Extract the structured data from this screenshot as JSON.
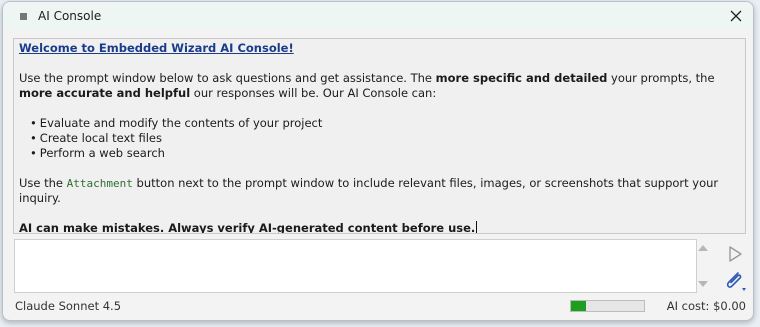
{
  "window": {
    "title": "AI Console"
  },
  "output": {
    "welcome": "Welcome to Embedded Wizard AI Console!",
    "intro": {
      "p1": "Use the prompt window below to ask questions and get assistance. The ",
      "b1": "more specific and detailed",
      "p2": " your prompts, the ",
      "b2": "more accurate and helpful",
      "p3": " our responses will be. Our AI Console can:"
    },
    "capabilities": [
      "Evaluate and modify the contents of your project",
      "Create local text files",
      "Perform a web search"
    ],
    "attachment_note": {
      "before": "Use the ",
      "keyword": "Attachment",
      "after": " button next to the prompt window to include relevant files, images, or screenshots that support your inquiry."
    },
    "warning": "AI can make mistakes. Always verify AI-generated content before use."
  },
  "prompt": {
    "value": ""
  },
  "status": {
    "model": "Claude Sonnet 4.5",
    "progress_fraction": 0.2,
    "cost": "AI cost: $0.00"
  },
  "icons": {
    "title": "window-icon",
    "close": "close-icon",
    "send": "send-icon",
    "attach": "paperclip-icon",
    "scroll_up": "scroll-up-icon",
    "scroll_down": "scroll-down-icon"
  },
  "colors": {
    "link": "#1a3c8a",
    "keyword": "#2f6f2f",
    "progress": "#1e9e1e"
  }
}
